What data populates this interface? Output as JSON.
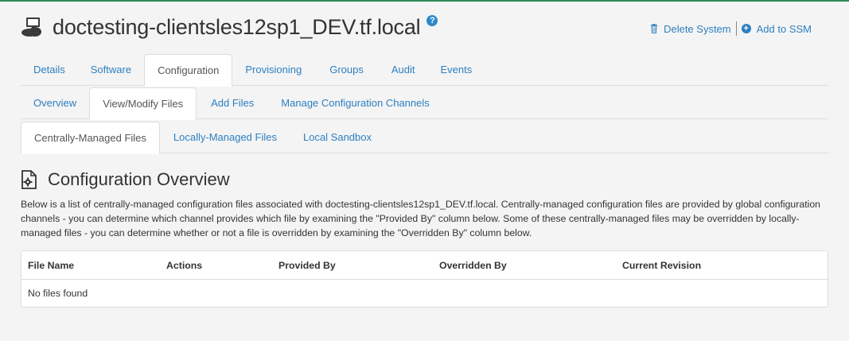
{
  "system": {
    "title": "doctesting-clientsles12sp1_DEV.tf.local",
    "help_glyph": "?"
  },
  "actions": {
    "delete_label": "Delete System",
    "add_ssm_label": "Add to SSM"
  },
  "main_tabs": [
    {
      "label": "Details"
    },
    {
      "label": "Software"
    },
    {
      "label": "Configuration",
      "active": true
    },
    {
      "label": "Provisioning"
    },
    {
      "label": "Groups"
    },
    {
      "label": "Audit"
    },
    {
      "label": "Events"
    }
  ],
  "sub_tabs": [
    {
      "label": "Overview"
    },
    {
      "label": "View/Modify Files",
      "active": true
    },
    {
      "label": "Add Files"
    },
    {
      "label": "Manage Configuration Channels"
    }
  ],
  "file_tabs": [
    {
      "label": "Centrally-Managed Files",
      "active": true
    },
    {
      "label": "Locally-Managed Files"
    },
    {
      "label": "Local Sandbox"
    }
  ],
  "section": {
    "title": "Configuration Overview",
    "description": "Below is a list of centrally-managed configuration files associated with doctesting-clientsles12sp1_DEV.tf.local. Centrally-managed configuration files are provided by global configuration channels - you can determine which channel provides which file by examining the \"Provided By\" column below. Some of these centrally-managed files may be overridden by locally-managed files - you can determine whether or not a file is overridden by examining the \"Overridden By\" column below."
  },
  "table": {
    "columns": [
      "File Name",
      "Actions",
      "Provided By",
      "Overridden By",
      "Current Revision"
    ],
    "empty_text": "No files found"
  },
  "colors": {
    "link": "#2d7fc1",
    "top_border": "#2e8b57",
    "background": "#f4f4f4"
  }
}
